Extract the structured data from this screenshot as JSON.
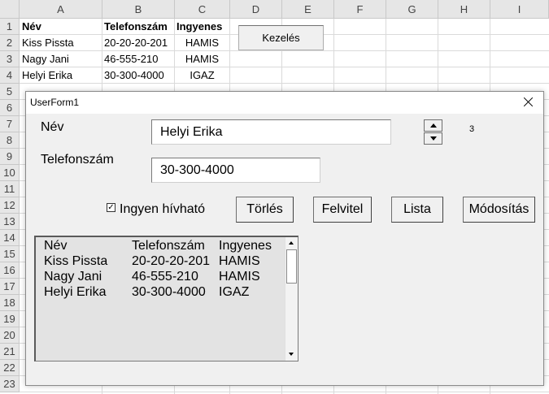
{
  "sheet": {
    "columns": [
      "A",
      "B",
      "C",
      "D",
      "E",
      "F",
      "G",
      "H",
      "I"
    ],
    "rows": [
      "1",
      "2",
      "3",
      "4",
      "5",
      "6",
      "7",
      "8",
      "9",
      "10",
      "11",
      "12",
      "13",
      "14",
      "15",
      "16",
      "17",
      "18",
      "19",
      "20",
      "21",
      "22",
      "23"
    ],
    "cells": {
      "A1": "Név",
      "B1": "Telefonszám",
      "C1": "Ingyenes",
      "A2": "Kiss Pissta",
      "B2": "20-20-20-201",
      "C2": "HAMIS",
      "A3": "Nagy Jani",
      "B3": "46-555-210",
      "C3": "HAMIS",
      "A4": "Helyi Erika",
      "B4": "30-300-4000",
      "C4": "IGAZ"
    },
    "button_label": "Kezelés"
  },
  "form": {
    "title": "UserForm1",
    "name_label": "Név",
    "name_value": "Helyi Erika",
    "phone_label": "Telefonszám",
    "phone_value": "30-300-4000",
    "spin_value": "3",
    "checkbox_label": "Ingyen hívható",
    "checkbox_mark": "✓",
    "buttons": {
      "delete": "Törlés",
      "add": "Felvitel",
      "list": "Lista",
      "modify": "Módosítás"
    },
    "list": {
      "header": [
        "Név",
        "Telefonszám",
        "Ingyenes"
      ],
      "rows": [
        [
          "Kiss Pissta",
          "20-20-20-201",
          "HAMIS"
        ],
        [
          "Nagy Jani",
          "46-555-210",
          "HAMIS"
        ],
        [
          "Helyi Erika",
          "30-300-4000",
          "IGAZ"
        ]
      ]
    }
  },
  "icons": {
    "close": "close-icon",
    "spin_up": "arrow-up-icon",
    "spin_down": "arrow-down-icon"
  }
}
